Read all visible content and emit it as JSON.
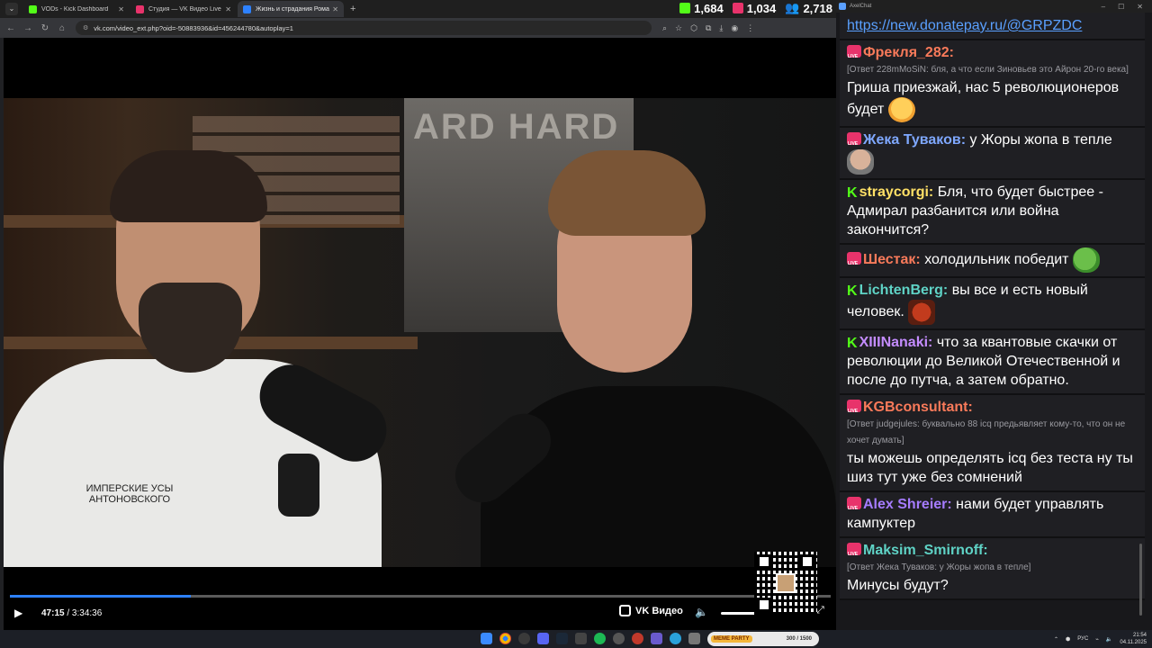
{
  "browser": {
    "tabs": [
      {
        "title": "VODs - Kick Dashboard",
        "color": "#53fc18",
        "active": false
      },
      {
        "title": "Студия — VK Видео Live",
        "color": "#e8336b",
        "active": false
      },
      {
        "title": "Жизнь и страдания Романа А",
        "color": "#2d81ff",
        "active": true
      }
    ],
    "url": "vk.com/video_ext.php?oid=-50883936&id=456244780&autoplay=1",
    "counters": {
      "kick": "1,684",
      "vklive": "1,034",
      "viewers": "2,718"
    }
  },
  "player": {
    "time_current": "47:15",
    "time_total": "3:34:36",
    "progress": 0.22,
    "brand": "VK Видео",
    "shirt_text": "ИМПЕРСКИЕ УСЫ АНТОНОВСКОГО"
  },
  "chat": {
    "app_title": "AxelChat",
    "top_link": "https://new.donatepay.ru/@GRPZDC",
    "messages": [
      {
        "badge": "live",
        "nick": "Фрекля_282:",
        "color": "#f97a5a",
        "reply": "[Ответ 228mMoSiN: бля, а что если Зиновьев это Айрон 20-го века]",
        "text": "Гриша приезжай, нас 5 революционеров будет",
        "emote": "blush"
      },
      {
        "badge": "live",
        "nick": "Жека Туваков:",
        "color": "#7fa8ff",
        "reply": "",
        "text": "у Жоры жопа в тепле",
        "emote": "face"
      },
      {
        "badge": "kick",
        "nick": "straycorgi:",
        "color": "#ffe066",
        "reply": "",
        "text": "Бля, что будет быстрее - Адмирал разбанится или война закончится?",
        "emote": ""
      },
      {
        "badge": "live",
        "nick": "Шестак:",
        "color": "#f97a5a",
        "reply": "",
        "text": "холодильник победит",
        "emote": "pepe"
      },
      {
        "badge": "kick",
        "nick": "LichtenBerg:",
        "color": "#5fd3c6",
        "reply": "",
        "text": "вы все и есть новый человек.",
        "emote": "mad"
      },
      {
        "badge": "kick",
        "nick": "XIIINanaki:",
        "color": "#c48cff",
        "reply": "",
        "text": "что за квантовые скачки от революции до Великой Отечественной и после до путча, а затем обратно.",
        "emote": ""
      },
      {
        "badge": "live",
        "nick": "KGBconsultant:",
        "color": "#f97a5a",
        "reply": "[Ответ judgejules: буквально 88 icq предьявляет кому-то, что он не хочет думать]",
        "text": "ты можешь определять icq без теста ну ты шиз тут уже без сомнений",
        "emote": ""
      },
      {
        "badge": "live",
        "nick": "Alex Shreier:",
        "color": "#a67cff",
        "reply": "",
        "text": "нами будет управлять кампуктер",
        "emote": ""
      },
      {
        "badge": "live",
        "nick": "Maksim_Smirnoff:",
        "color": "#5fd3c6",
        "reply": "[Ответ Жека Туваков: у Жоры жопа в тепле]",
        "text": "Минусы будут?",
        "emote": ""
      }
    ]
  },
  "taskbar": {
    "widget_label": "MEME PARTY",
    "widget_count": "300 / 1500",
    "lang": "РУС",
    "time": "21:54",
    "date": "04.11.2025"
  }
}
